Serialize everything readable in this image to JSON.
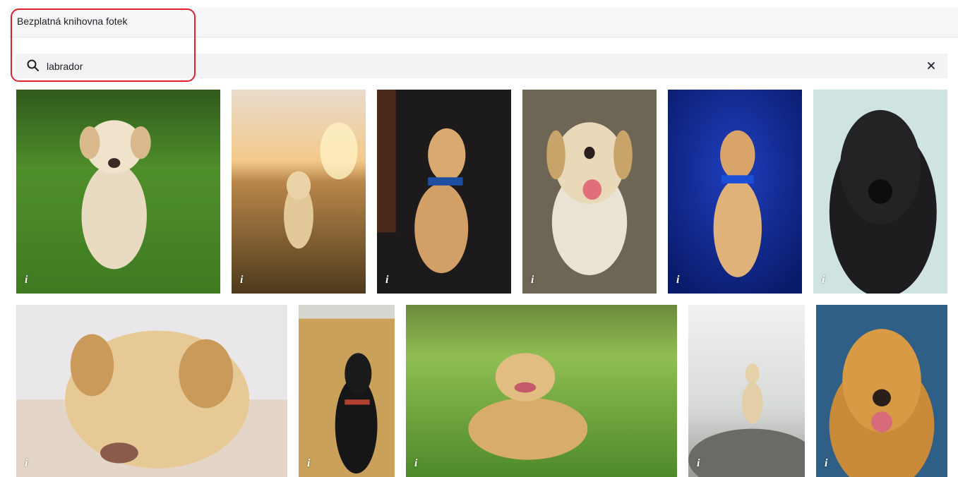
{
  "header": {
    "title": "Bezplatná knihovna fotek"
  },
  "search": {
    "value": "labrador",
    "search_icon": "search-icon",
    "clear_icon": "close-icon",
    "clear_label": "×"
  },
  "photos": [
    {
      "info_label": "i",
      "subject": "yellow labrador puppy walking on grass"
    },
    {
      "info_label": "i",
      "subject": "labrador in field at sunset"
    },
    {
      "info_label": "i",
      "subject": "labrador puppy with blue collar on dark background"
    },
    {
      "info_label": "i",
      "subject": "smiling labrador with tongue out"
    },
    {
      "info_label": "i",
      "subject": "labrador puppy on blue background"
    },
    {
      "info_label": "i",
      "subject": "black labrador portrait"
    },
    {
      "info_label": "i",
      "subject": "yellow labrador lying down close-up"
    },
    {
      "info_label": "i",
      "subject": "black labrador in wheat field"
    },
    {
      "info_label": "i",
      "subject": "golden retriever lying on grass with flowers"
    },
    {
      "info_label": "i",
      "subject": "labrador sitting on rock in fog"
    },
    {
      "info_label": "i",
      "subject": "golden retriever on blue background"
    }
  ]
}
